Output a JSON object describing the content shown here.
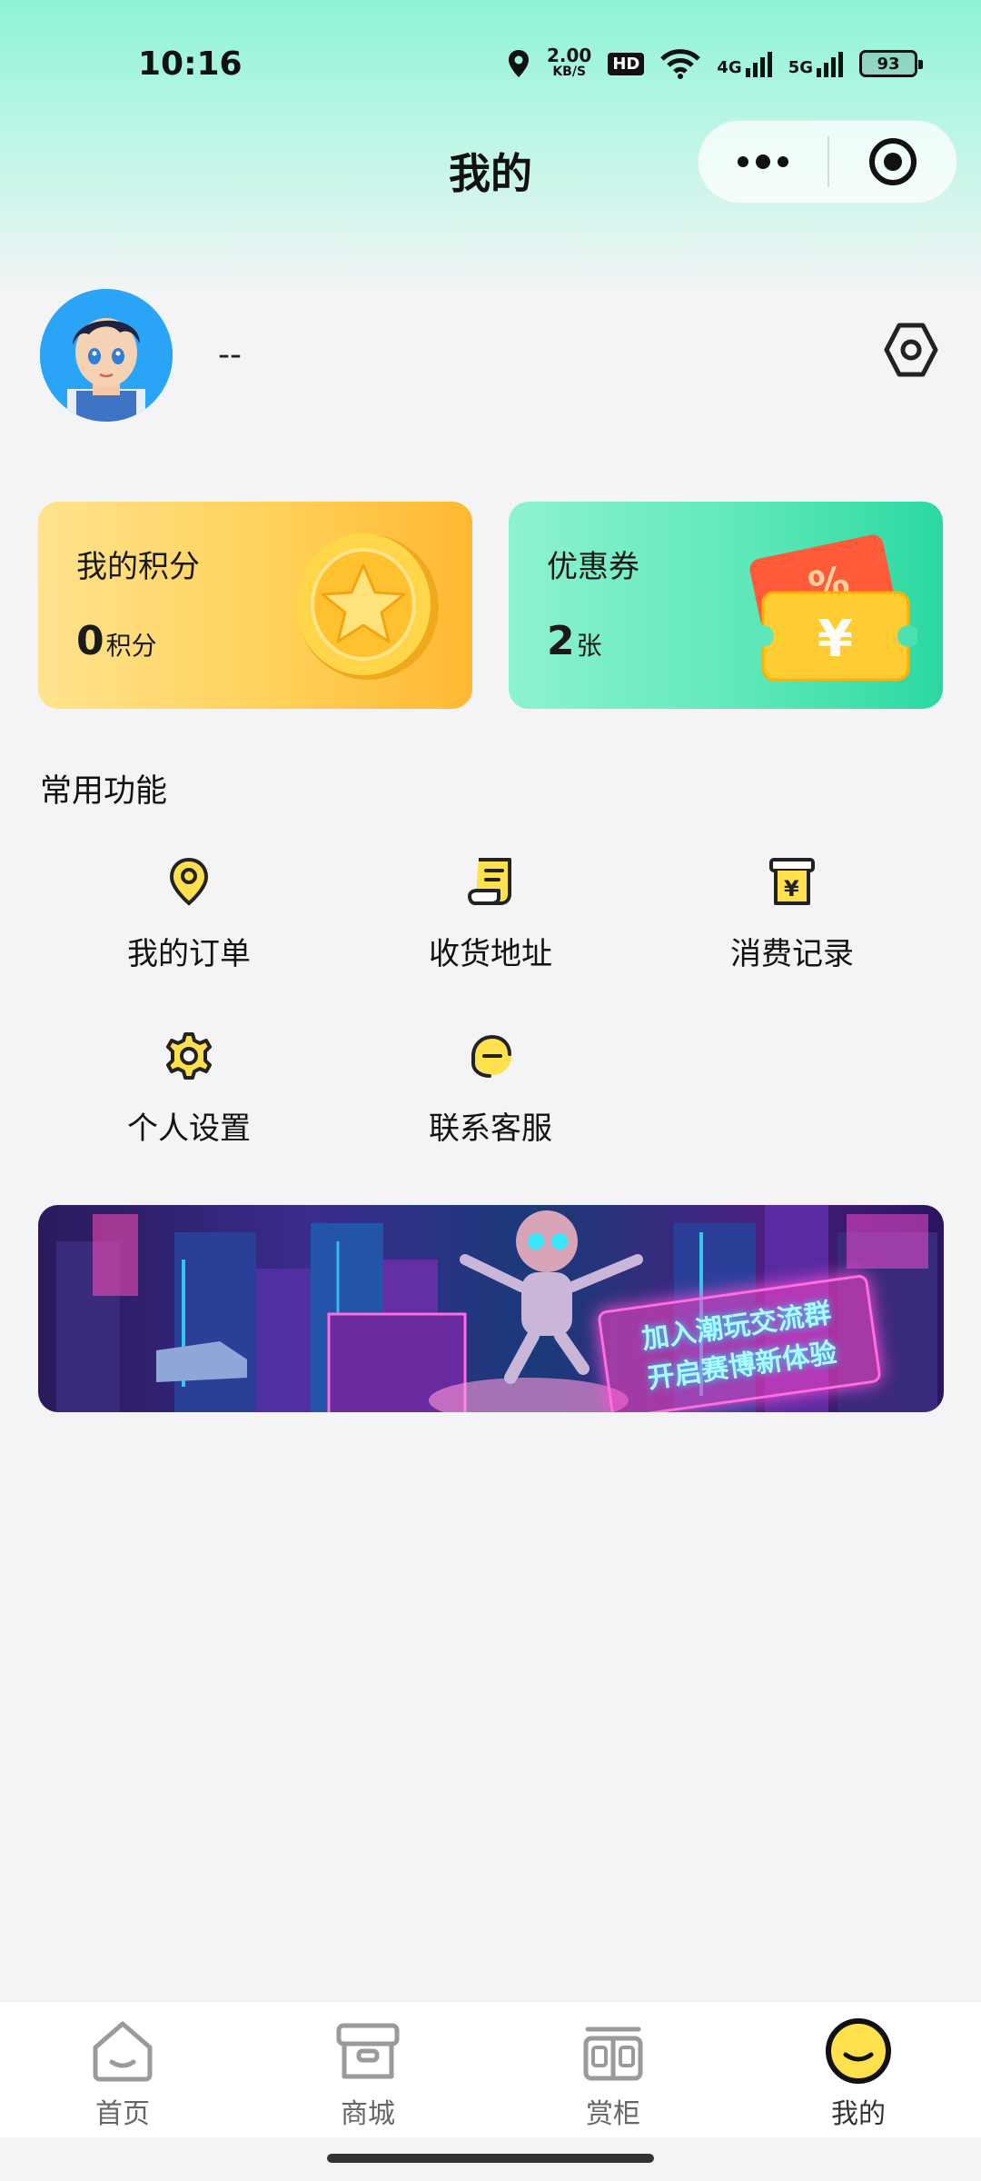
{
  "status_bar": {
    "time": "10:16",
    "speed_value": "2.00",
    "speed_unit": "KB/S",
    "hd": "HD",
    "net1": "4G",
    "net2": "5G",
    "battery": "93"
  },
  "nav": {
    "title": "我的"
  },
  "profile": {
    "username": "--"
  },
  "cards": {
    "points": {
      "title": "我的积分",
      "value": "0",
      "unit": "积分"
    },
    "coupons": {
      "title": "优惠券",
      "value": "2",
      "unit": "张"
    }
  },
  "functions": {
    "section_title": "常用功能",
    "items": [
      {
        "label": "我的订单",
        "icon": "location-pin-icon"
      },
      {
        "label": "收货地址",
        "icon": "scroll-document-icon"
      },
      {
        "label": "消费记录",
        "icon": "receipt-yen-icon"
      },
      {
        "label": "个人设置",
        "icon": "gear-icon"
      },
      {
        "label": "联系客服",
        "icon": "headset-icon"
      }
    ]
  },
  "banner": {
    "line1": "加入潮玩交流群",
    "line2": "开启赛博新体验"
  },
  "tabbar": {
    "items": [
      {
        "label": "首页",
        "icon": "home-icon",
        "active": false
      },
      {
        "label": "商城",
        "icon": "shop-icon",
        "active": false
      },
      {
        "label": "赏柜",
        "icon": "cabinet-icon",
        "active": false
      },
      {
        "label": "我的",
        "icon": "smiley-icon",
        "active": true
      }
    ]
  },
  "colors": {
    "header_gradient_top": "#8ef3d6",
    "points_card": "#ffd159",
    "coupon_card": "#5ee8b9",
    "accent_yellow": "#ffe14d",
    "page_bg": "#f4f4f6"
  }
}
